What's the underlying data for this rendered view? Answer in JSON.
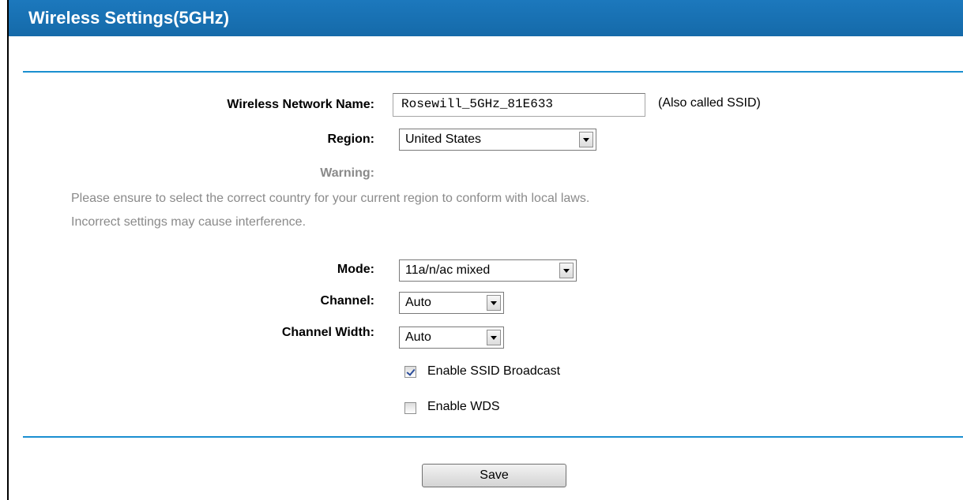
{
  "header": {
    "title": "Wireless Settings(5GHz)"
  },
  "form": {
    "network_name": {
      "label": "Wireless Network Name:",
      "value": "Rosewill_5GHz_81E633",
      "hint": "(Also called SSID)"
    },
    "region": {
      "label": "Region:",
      "selected": "United States"
    },
    "warning": {
      "label": "Warning:",
      "line1": "Please ensure to select the correct country for your current region to conform with local laws.",
      "line2": "Incorrect settings may cause interference."
    },
    "mode": {
      "label": "Mode:",
      "selected": "11a/n/ac mixed"
    },
    "channel": {
      "label": "Channel:",
      "selected": "Auto"
    },
    "channel_width": {
      "label": "Channel Width:",
      "selected": "Auto"
    },
    "ssid_broadcast": {
      "label": "Enable SSID Broadcast",
      "checked": true
    },
    "wds": {
      "label": "Enable WDS",
      "checked": false
    }
  },
  "actions": {
    "save_label": "Save"
  },
  "colors": {
    "title_bar": "#1a73b8",
    "divider": "#1a8fd0",
    "warning_text": "#8a8a8a"
  }
}
